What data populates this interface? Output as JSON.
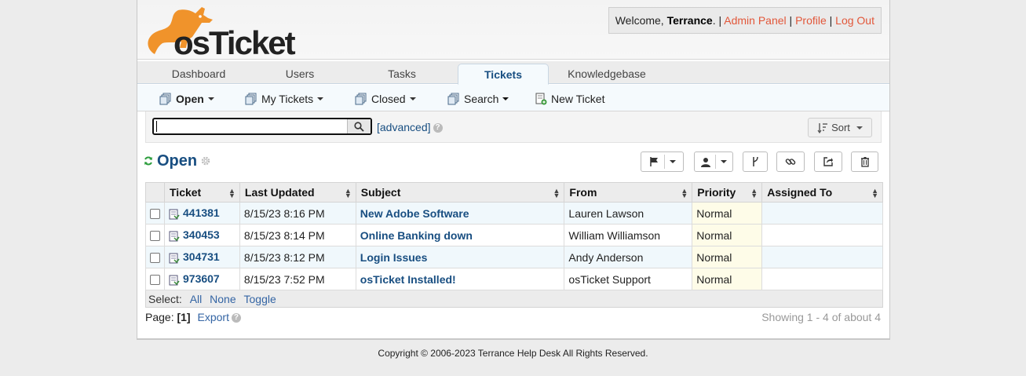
{
  "header": {
    "logo_text": "osTicket",
    "welcome_prefix": "Welcome, ",
    "user_name": "Terrance",
    "welcome_suffix": ". | ",
    "admin_panel": "Admin Panel",
    "profile": "Profile",
    "logout": "Log Out",
    "sep": "|"
  },
  "nav": {
    "tabs": [
      {
        "label": "Dashboard"
      },
      {
        "label": "Users"
      },
      {
        "label": "Tasks"
      },
      {
        "label": "Tickets",
        "active": true
      },
      {
        "label": "Knowledgebase"
      }
    ]
  },
  "subnav": {
    "items": [
      {
        "label": "Open",
        "bold": true,
        "dropdown": true
      },
      {
        "label": "My Tickets",
        "dropdown": true
      },
      {
        "label": "Closed",
        "dropdown": true
      },
      {
        "label": "Search",
        "dropdown": true
      },
      {
        "label": "New Ticket",
        "dropdown": false
      }
    ]
  },
  "search": {
    "value": "",
    "advanced": "[advanced]",
    "help": "?",
    "sort": "Sort"
  },
  "page": {
    "title": "Open"
  },
  "table": {
    "columns": [
      "Ticket",
      "Last Updated",
      "Subject",
      "From",
      "Priority",
      "Assigned To"
    ],
    "rows": [
      {
        "number": "441381",
        "updated": "8/15/23 8:16 PM",
        "subject": "New Adobe Software",
        "from": "Lauren Lawson",
        "priority": "Normal",
        "assigned": ""
      },
      {
        "number": "340453",
        "updated": "8/15/23 8:14 PM",
        "subject": "Online Banking down",
        "from": "William Williamson",
        "priority": "Normal",
        "assigned": ""
      },
      {
        "number": "304731",
        "updated": "8/15/23 8:12 PM",
        "subject": "Login Issues",
        "from": "Andy Anderson",
        "priority": "Normal",
        "assigned": ""
      },
      {
        "number": "973607",
        "updated": "8/15/23 7:52 PM",
        "subject": "osTicket Installed!",
        "from": "osTicket Support",
        "priority": "Normal",
        "assigned": ""
      }
    ]
  },
  "select": {
    "label": "Select:",
    "all": "All",
    "none": "None",
    "toggle": "Toggle"
  },
  "pager": {
    "label": "Page:",
    "current": "[1]",
    "export": "Export",
    "showing": "Showing 1 - 4 of about 4"
  },
  "footer": {
    "copyright": "Copyright © 2006-2023 Terrance Help Desk All Rights Reserved."
  },
  "colors": {
    "link": "#184e81",
    "accent_orange": "#e2573a",
    "logo_orange": "#f0932b"
  }
}
